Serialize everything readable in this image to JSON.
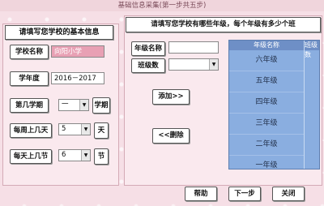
{
  "window": {
    "title": "基础信息采集(第一步共五步)"
  },
  "left": {
    "header": "请填写您学校的基本信息",
    "school_name_label": "学校名称",
    "school_name_value": "向阳小学",
    "school_year_label": "学年度",
    "school_year_value": "2016－2017",
    "semester_label": "第几学期",
    "semester_value": "一",
    "semester_unit": "学期",
    "days_label": "每周上几天",
    "days_value": "5",
    "days_unit": "天",
    "periods_label": "每天上几节",
    "periods_value": "6",
    "periods_unit": "节"
  },
  "right": {
    "header": "请填写您学校有哪些年级，每个年级有多少个班",
    "grade_name_label": "年级名称",
    "grade_name_value": "",
    "class_count_label": "班级数",
    "class_count_value": "",
    "add_button": "添加>>",
    "delete_button": "<<删除",
    "table": {
      "columns": [
        "年级名称",
        "班级数"
      ],
      "rows": [
        "六年级",
        "五年级",
        "四年级",
        "三年级",
        "二年级",
        "一年级"
      ]
    }
  },
  "footer": {
    "help": "帮助",
    "next": "下一步",
    "close": "关闭"
  }
}
